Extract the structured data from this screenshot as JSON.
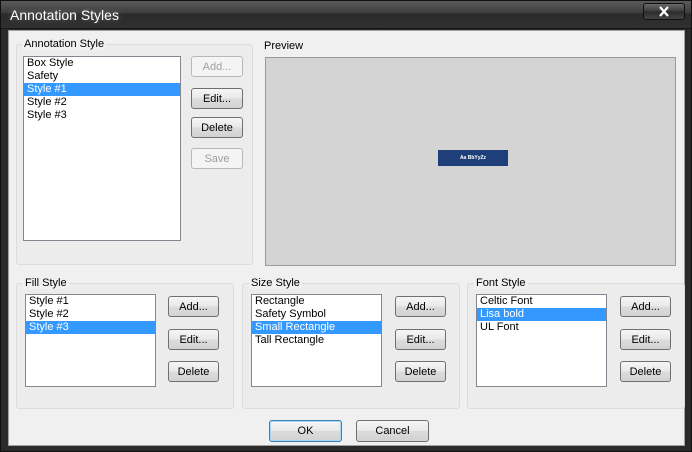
{
  "window": {
    "title": "Annotation Styles"
  },
  "annotation_style": {
    "label": "Annotation Style",
    "items": [
      "Box Style",
      "Safety",
      "Style #1",
      "Style #2",
      "Style #3"
    ],
    "selected_index": 2,
    "buttons": {
      "add": "Add...",
      "edit": "Edit...",
      "delete": "Delete",
      "save": "Save"
    }
  },
  "preview": {
    "label": "Preview",
    "sample_text": "Aa BbYyZz",
    "sample_bg": "#1f3f7a"
  },
  "fill_style": {
    "label": "Fill Style",
    "items": [
      "Style #1",
      "Style #2",
      "Style #3"
    ],
    "selected_index": 2,
    "buttons": {
      "add": "Add...",
      "edit": "Edit...",
      "delete": "Delete"
    }
  },
  "size_style": {
    "label": "Size Style",
    "items": [
      "Rectangle",
      "Safety Symbol",
      "Small Rectangle",
      "Tall Rectangle"
    ],
    "selected_index": 2,
    "buttons": {
      "add": "Add...",
      "edit": "Edit...",
      "delete": "Delete"
    }
  },
  "font_style": {
    "label": "Font Style",
    "items": [
      "Celtic Font",
      "Lisa bold",
      "UL Font"
    ],
    "selected_index": 1,
    "buttons": {
      "add": "Add...",
      "edit": "Edit...",
      "delete": "Delete"
    }
  },
  "footer": {
    "ok": "OK",
    "cancel": "Cancel"
  },
  "colors": {
    "selection": "#3399ff",
    "dialog_bg": "#f0f0f0"
  }
}
